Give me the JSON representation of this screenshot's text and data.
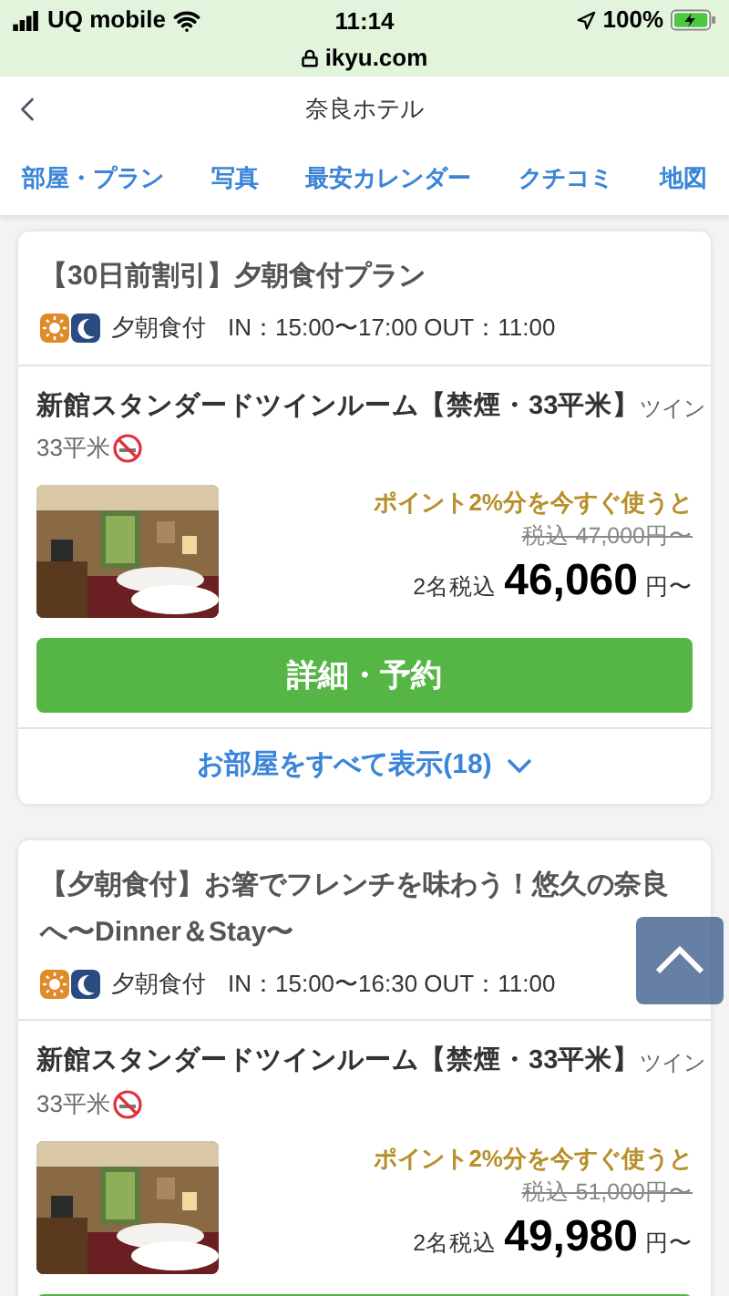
{
  "status_bar": {
    "carrier": "UQ mobile",
    "time": "11:14",
    "battery": "100%",
    "url": "ikyu.com"
  },
  "header": {
    "title": "奈良ホテル"
  },
  "tabs": [
    {
      "label": "部屋・プラン"
    },
    {
      "label": "写真"
    },
    {
      "label": "最安カレンダー"
    },
    {
      "label": "クチコミ"
    },
    {
      "label": "地図"
    }
  ],
  "plans": [
    {
      "title": "【30日前割引】夕朝食付プラン",
      "meal": "夕朝食付",
      "checkin": "IN：15:00〜17:00 OUT：11:00",
      "room": "新館スタンダードツインルーム【禁煙・33平米】",
      "room_type": "ツイン",
      "area": "33平米",
      "points": "ポイント2%分を今すぐ使うと",
      "old_price": "税込 47,000円〜",
      "guests": "2名税込",
      "price": "46,060",
      "unit": "円〜",
      "button": "詳細・予約",
      "show_all": "お部屋をすべて表示(18)"
    },
    {
      "title": "【夕朝食付】お箸でフレンチを味わう！悠久の奈良へ〜Dinner＆Stay〜",
      "meal": "夕朝食付",
      "checkin": "IN：15:00〜16:30 OUT：11:00",
      "room": "新館スタンダードツインルーム【禁煙・33平米】",
      "room_type": "ツイン",
      "area": "33平米",
      "points": "ポイント2%分を今すぐ使うと",
      "old_price": "税込 51,000円〜",
      "guests": "2名税込",
      "price": "49,980",
      "unit": "円〜"
    }
  ]
}
